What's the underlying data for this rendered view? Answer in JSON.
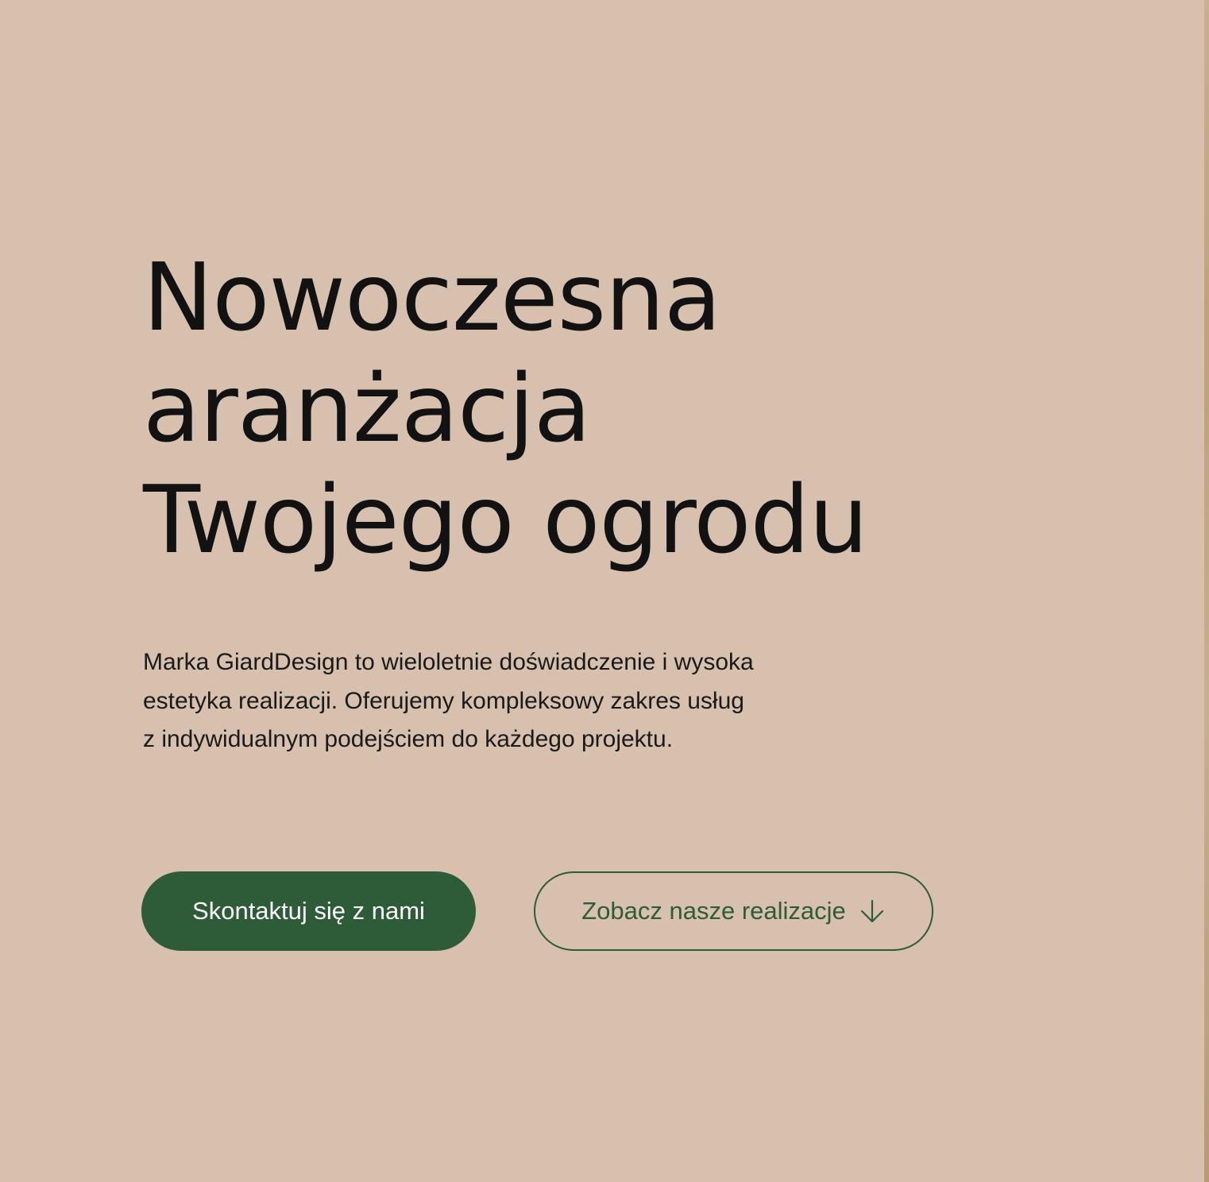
{
  "hero": {
    "heading_lines": [
      "Nowoczesna",
      "aranżacja",
      "Twojego ogrodu"
    ],
    "description_lines": [
      "Marka GiardDesign to wieloletnie doświadczenie i wysoka",
      "estetyka realizacji. Oferujemy kompleksowy zakres usług",
      "z indywidualnym podejściem do każdego projektu."
    ],
    "primary_button_label": "Skontaktuj się z nami",
    "secondary_button_label": "Zobacz nasze realizacje",
    "secondary_button_icon": "arrow-down-icon"
  },
  "colors": {
    "background": "#d7c0ae",
    "heading_text": "#121212",
    "body_text": "#1a1a1a",
    "accent_green": "#2e5b38",
    "button_text_on_green": "#ffffff"
  }
}
